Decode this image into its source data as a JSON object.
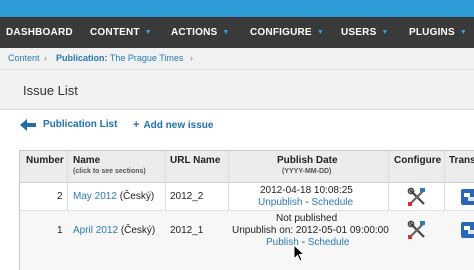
{
  "nav": {
    "items": [
      {
        "label": "DASHBOARD",
        "has_caret": false
      },
      {
        "label": "CONTENT",
        "has_caret": true
      },
      {
        "label": "ACTIONS",
        "has_caret": true
      },
      {
        "label": "CONFIGURE",
        "has_caret": true
      },
      {
        "label": "USERS",
        "has_caret": true
      },
      {
        "label": "PLUGINS",
        "has_caret": true
      }
    ],
    "caret_glyph": "▼"
  },
  "breadcrumb": {
    "content": "Content",
    "publication_label": "Publication:",
    "publication_name": "The Prague Times",
    "separator": "›"
  },
  "page": {
    "title": "Issue List"
  },
  "actions": {
    "publication_list": "Publication List",
    "add_new_issue": "Add new issue",
    "plus": "+"
  },
  "table": {
    "headers": {
      "number": "Number",
      "name": "Name",
      "name_sub": "(click to see sections)",
      "url_name": "URL Name",
      "publish_date": "Publish Date",
      "publish_date_sub": "(YYYY-MM-DD)",
      "configure": "Configure",
      "translate": "Trans"
    },
    "rows": [
      {
        "number": "2",
        "name_link": "May 2012",
        "language": "(Český)",
        "url_name": "2012_2",
        "date_line1": "2012-04-18 10:08:25",
        "date_line2": "",
        "action_a": "Unpublish",
        "action_sep": " - ",
        "action_b": "Schedule"
      },
      {
        "number": "1",
        "name_link": "April 2012",
        "language": "(Český)",
        "url_name": "2012_1",
        "date_line1": "Not published",
        "date_line2": "Unpublish on: 2012-05-01 09:00:00",
        "action_a": "Publish",
        "action_sep": " - ",
        "action_b": "Schedule"
      }
    ]
  },
  "colors": {
    "top_strip": "#2c9bd6",
    "nav_bg": "#3a3a3a",
    "link": "#2a7ab8",
    "caret": "#3aa0e0"
  }
}
